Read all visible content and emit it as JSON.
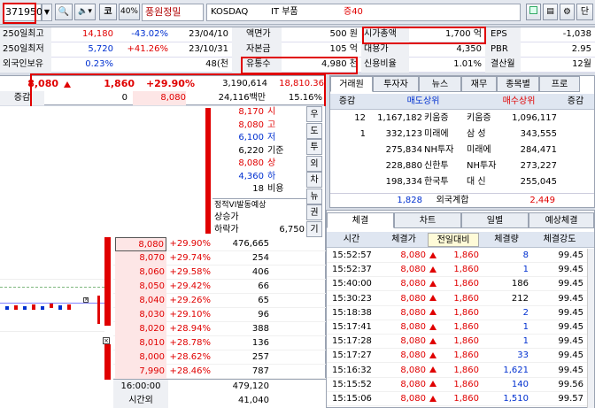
{
  "toolbar": {
    "code": "371950",
    "market_btn": "코",
    "pct_btn": "40%",
    "company": "풍원정밀",
    "market": "KOSDAQ",
    "sector": "IT 부품",
    "margin": "증40",
    "right_btn": "단"
  },
  "info": {
    "rows": [
      {
        "l1": "250일최고",
        "v1": "14,180",
        "p1": "-43.02%",
        "d1": "23/04/10",
        "l2": "액면가",
        "v2": "500 원",
        "l3": "시가총액",
        "v3": "1,700 억",
        "l4": "EPS",
        "v4": "-1,038"
      },
      {
        "l1": "250일최저",
        "v1": "5,720",
        "p1": "+41.26%",
        "d1": "23/10/31",
        "l2": "자본금",
        "v2": "105 억",
        "l3": "대용가",
        "v3": "4,350",
        "l4": "PBR",
        "v4": "2.95"
      },
      {
        "l1": "외국인보유",
        "v1": "0.23%",
        "p1": "",
        "d1": "48(천",
        "l2": "유통수",
        "v2": "4,980 천",
        "l3": "신용비율",
        "v3": "1.01%",
        "l4": "결산월",
        "v4": "12월"
      }
    ]
  },
  "price": {
    "current": "8,080",
    "change": "1,860",
    "rate": "+29.90%",
    "volume": "3,190,614",
    "volume_rate": "18,810.36",
    "label": "증감",
    "diff": "0",
    "amount_price": "8,080",
    "amount": "24,116백만",
    "turnover": "15.16%"
  },
  "stats": [
    {
      "v": "8,170",
      "t": "시"
    },
    {
      "v": "8,080",
      "t": "고"
    },
    {
      "v": "6,100",
      "t": "저"
    },
    {
      "v": "6,220",
      "t": "기준"
    },
    {
      "v": "8,080",
      "t": "상"
    },
    {
      "v": "4,360",
      "t": "하"
    },
    {
      "v": "18",
      "t": "비용"
    }
  ],
  "vi": {
    "title": "정적VI발동예상",
    "up_label": "상승가",
    "down_label": "하락가",
    "down_value": "6,750"
  },
  "side_buttons": [
    "우",
    "도",
    "투",
    "외",
    "차",
    "뉴",
    "권",
    "기"
  ],
  "orderbook": [
    {
      "price": "8,080",
      "rate": "+29.90%",
      "qty": "476,665"
    },
    {
      "price": "8,070",
      "rate": "+29.74%",
      "qty": "254"
    },
    {
      "price": "8,060",
      "rate": "+29.58%",
      "qty": "406"
    },
    {
      "price": "8,050",
      "rate": "+29.42%",
      "qty": "66"
    },
    {
      "price": "8,040",
      "rate": "+29.26%",
      "qty": "65"
    },
    {
      "price": "8,030",
      "rate": "+29.10%",
      "qty": "96"
    },
    {
      "price": "8,020",
      "rate": "+28.94%",
      "qty": "388"
    },
    {
      "price": "8,010",
      "rate": "+28.78%",
      "qty": "136"
    },
    {
      "price": "8,000",
      "rate": "+28.62%",
      "qty": "257"
    },
    {
      "price": "7,990",
      "rate": "+28.46%",
      "qty": "787"
    }
  ],
  "total": {
    "time": "16:00:00",
    "after_label": "시간외",
    "total_qty": "479,120",
    "after_qty": "41,040"
  },
  "broker_tabs": [
    "거래원",
    "투자자",
    "뉴스",
    "재무",
    "종목별",
    "프로"
  ],
  "broker": {
    "h_diff": "증감",
    "h_sell": "매도상위",
    "h_buy": "매수상위",
    "h_diff2": "증감",
    "rows": [
      {
        "d": "12",
        "sq": "1,167,182",
        "sn": "키움증",
        "bn": "키움증",
        "bq": "1,096,117"
      },
      {
        "d": "1",
        "sq": "332,123",
        "sn": "미래에",
        "bn": "삼 성",
        "bq": "343,555"
      },
      {
        "d": "",
        "sq": "275,834",
        "sn": "NH투자",
        "bn": "미래에",
        "bq": "284,471"
      },
      {
        "d": "",
        "sq": "228,880",
        "sn": "신한투",
        "bn": "NH투자",
        "bq": "273,227"
      },
      {
        "d": "",
        "sq": "198,334",
        "sn": "한국투",
        "bn": "대 신",
        "bq": "255,045"
      }
    ],
    "foreign_sell": "1,828",
    "foreign_label": "외국계합",
    "foreign_buy": "2,449"
  },
  "trade_tabs": [
    "체결",
    "차트",
    "일별",
    "예상체결"
  ],
  "trades": {
    "h": [
      "시간",
      "체결가",
      "전일대비",
      "체결량",
      "체결강도"
    ],
    "rows": [
      {
        "t": "15:52:57",
        "p": "8,080",
        "c": "1,860",
        "q": "8",
        "s": "99.45"
      },
      {
        "t": "15:52:37",
        "p": "8,080",
        "c": "1,860",
        "q": "1",
        "s": "99.45"
      },
      {
        "t": "15:40:00",
        "p": "8,080",
        "c": "1,860",
        "q": "186",
        "s": "99.45"
      },
      {
        "t": "15:30:23",
        "p": "8,080",
        "c": "1,860",
        "q": "212",
        "s": "99.45"
      },
      {
        "t": "15:18:38",
        "p": "8,080",
        "c": "1,860",
        "q": "2",
        "s": "99.45"
      },
      {
        "t": "15:17:41",
        "p": "8,080",
        "c": "1,860",
        "q": "1",
        "s": "99.45"
      },
      {
        "t": "15:17:28",
        "p": "8,080",
        "c": "1,860",
        "q": "1",
        "s": "99.45"
      },
      {
        "t": "15:17:27",
        "p": "8,080",
        "c": "1,860",
        "q": "33",
        "s": "99.45"
      },
      {
        "t": "15:16:32",
        "p": "8,080",
        "c": "1,860",
        "q": "1,621",
        "s": "99.45"
      },
      {
        "t": "15:15:52",
        "p": "8,080",
        "c": "1,860",
        "q": "140",
        "s": "99.56"
      },
      {
        "t": "15:15:06",
        "p": "8,080",
        "c": "1,860",
        "q": "1,510",
        "s": "99.57"
      }
    ]
  },
  "colors": {
    "up": "#e00000",
    "down": "#0030d0",
    "highlight": "#e00000"
  }
}
